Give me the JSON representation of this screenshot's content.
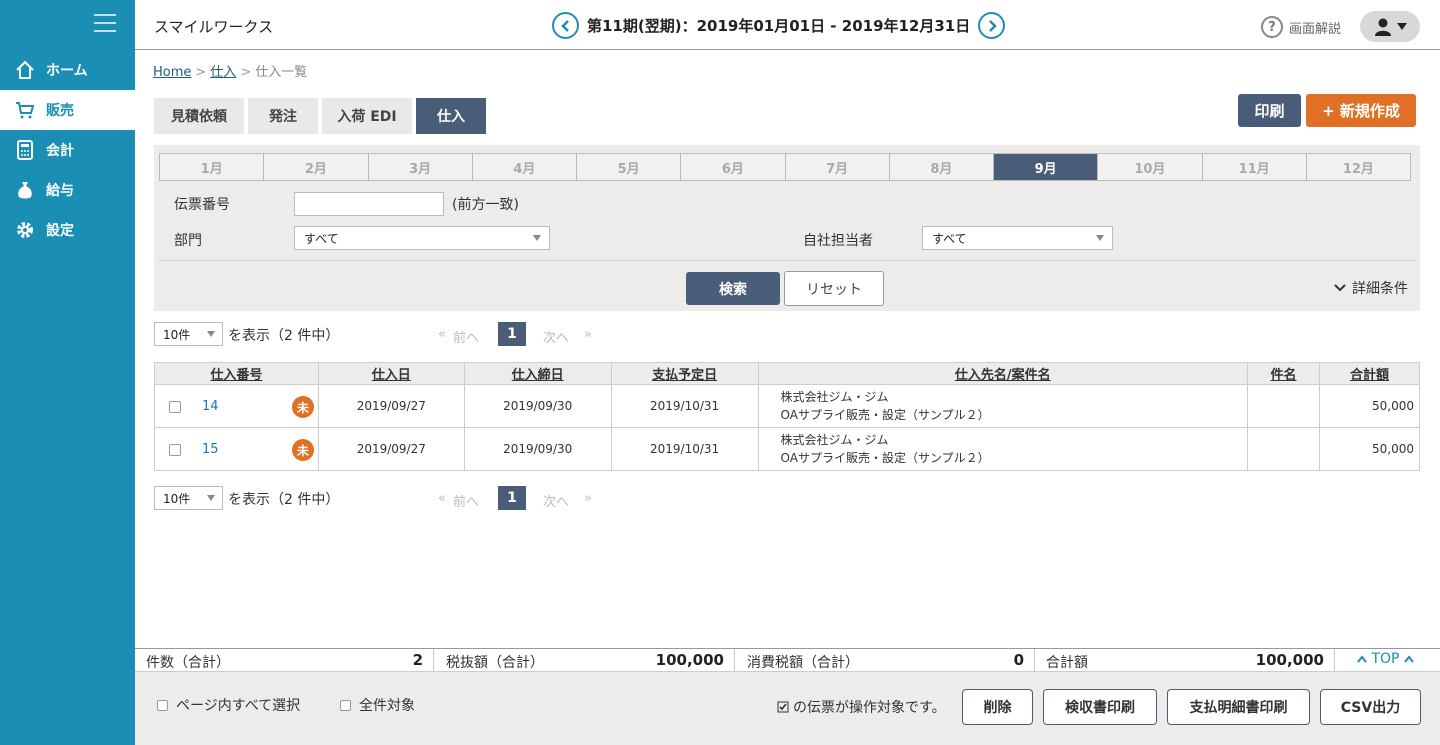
{
  "app": {
    "company": "スマイルワークス"
  },
  "header": {
    "period": "第11期(翌期)：2019年01月01日 - 2019年12月31日",
    "help_label": "画面解説"
  },
  "sidebar": {
    "items": [
      {
        "label": "ホーム",
        "icon": "home-icon"
      },
      {
        "label": "販売",
        "icon": "cart-icon"
      },
      {
        "label": "会計",
        "icon": "calculator-icon"
      },
      {
        "label": "給与",
        "icon": "money-bag-icon"
      },
      {
        "label": "設定",
        "icon": "gear-icon"
      }
    ],
    "active": "販売"
  },
  "breadcrumb": {
    "home": "Home",
    "parent": "仕入",
    "current": "仕入一覧",
    "sep": ">"
  },
  "tabs": [
    {
      "label": "見積依頼"
    },
    {
      "label": "発注"
    },
    {
      "label": "入荷 EDI"
    },
    {
      "label": "仕入"
    }
  ],
  "actions": {
    "print": "印刷",
    "new": "+ 新規作成"
  },
  "months": [
    "1月",
    "2月",
    "3月",
    "4月",
    "5月",
    "6月",
    "7月",
    "8月",
    "9月",
    "10月",
    "11月",
    "12月"
  ],
  "active_month": "9月",
  "filters": {
    "voucher_label": "伝票番号",
    "voucher_value": "",
    "voucher_note": "(前方一致)",
    "dept_label": "部門",
    "dept_value": "すべて",
    "staff_label": "自社担当者",
    "staff_value": "すべて",
    "search": "検索",
    "reset": "リセット",
    "detail": "詳細条件"
  },
  "pager": {
    "per_page": "10件",
    "display_text": "を表示（2 件中）",
    "first": "«",
    "prev": "前へ",
    "current": "1",
    "next": "次へ",
    "last": "»"
  },
  "table": {
    "headers": [
      "仕入番号",
      "仕入日",
      "仕入締日",
      "支払予定日",
      "仕入先名/案件名",
      "件名",
      "合計額"
    ],
    "rows": [
      {
        "no": "14",
        "status": "未",
        "date": "2019/09/27",
        "close": "2019/09/30",
        "pay": "2019/10/31",
        "supplier": "株式会社ジム・ジム",
        "project": "OAサプライ販売・設定（サンプル２）",
        "subject": "",
        "total": "50,000"
      },
      {
        "no": "15",
        "status": "未",
        "date": "2019/09/27",
        "close": "2019/09/30",
        "pay": "2019/10/31",
        "supplier": "株式会社ジム・ジム",
        "project": "OAサプライ販売・設定（サンプル２）",
        "subject": "",
        "total": "50,000"
      }
    ]
  },
  "summary": {
    "count_label": "件数（合計）",
    "count": "2",
    "pretax_label": "税抜額（合計）",
    "pretax": "100,000",
    "tax_label": "消費税額（合計）",
    "tax": "0",
    "total_label": "合計額",
    "total": "100,000",
    "top": "TOP"
  },
  "footer": {
    "select_page": "ページ内すべて選択",
    "select_all": "全件対象",
    "note": "の伝票が操作対象です。",
    "delete": "削除",
    "receipt": "検収書印刷",
    "payment": "支払明細書印刷",
    "csv": "CSV出力"
  },
  "colors": {
    "sidebar": "#1b8fb3",
    "dark": "#4a5d78",
    "accent": "#e07025",
    "panel": "#eeebeb"
  }
}
